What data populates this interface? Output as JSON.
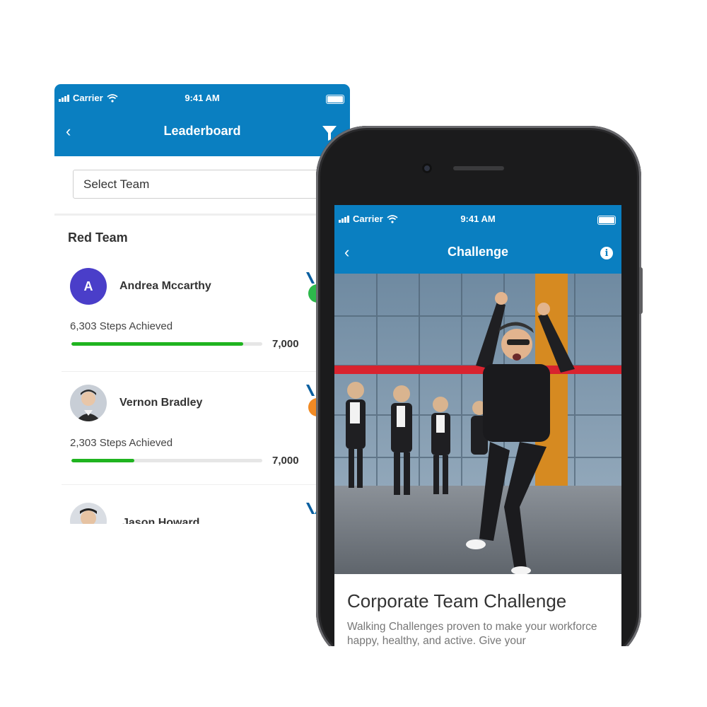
{
  "leaderboard": {
    "status": {
      "carrier": "Carrier",
      "time": "9:41 AM"
    },
    "nav": {
      "back": "‹",
      "title": "Leaderboard",
      "filter_icon": "filter-icon"
    },
    "select_team": {
      "label": "Select Team",
      "chevron": ">"
    },
    "team_name": "Red Team",
    "members": [
      {
        "name": "Andrea Mccarthy",
        "initial": "A",
        "steps": "6,303 Steps Achieved",
        "goal": "7,000",
        "progress": 0.9,
        "medal_color": "#2db84b"
      },
      {
        "name": "Vernon Bradley",
        "initial": "",
        "steps": "2,303 Steps Achieved",
        "goal": "7,000",
        "progress": 0.33,
        "medal_color": "#f08a24"
      },
      {
        "name": "Jason Howard",
        "initial": "",
        "steps": "",
        "goal": "",
        "progress": null,
        "medal_color": "#0a7fc1"
      }
    ]
  },
  "challenge": {
    "status": {
      "carrier": "Carrier",
      "time": "9:41 AM"
    },
    "nav": {
      "back": "‹",
      "title": "Challenge",
      "info_icon": "info-icon"
    },
    "title": "Corporate Team Challenge",
    "description": "Walking Challenges proven to make your workforce happy, healthy, and active. Give your"
  },
  "colors": {
    "brand": "#0a7fc1",
    "progress": "#1fb41f",
    "avatar": "#4a3ec9"
  }
}
